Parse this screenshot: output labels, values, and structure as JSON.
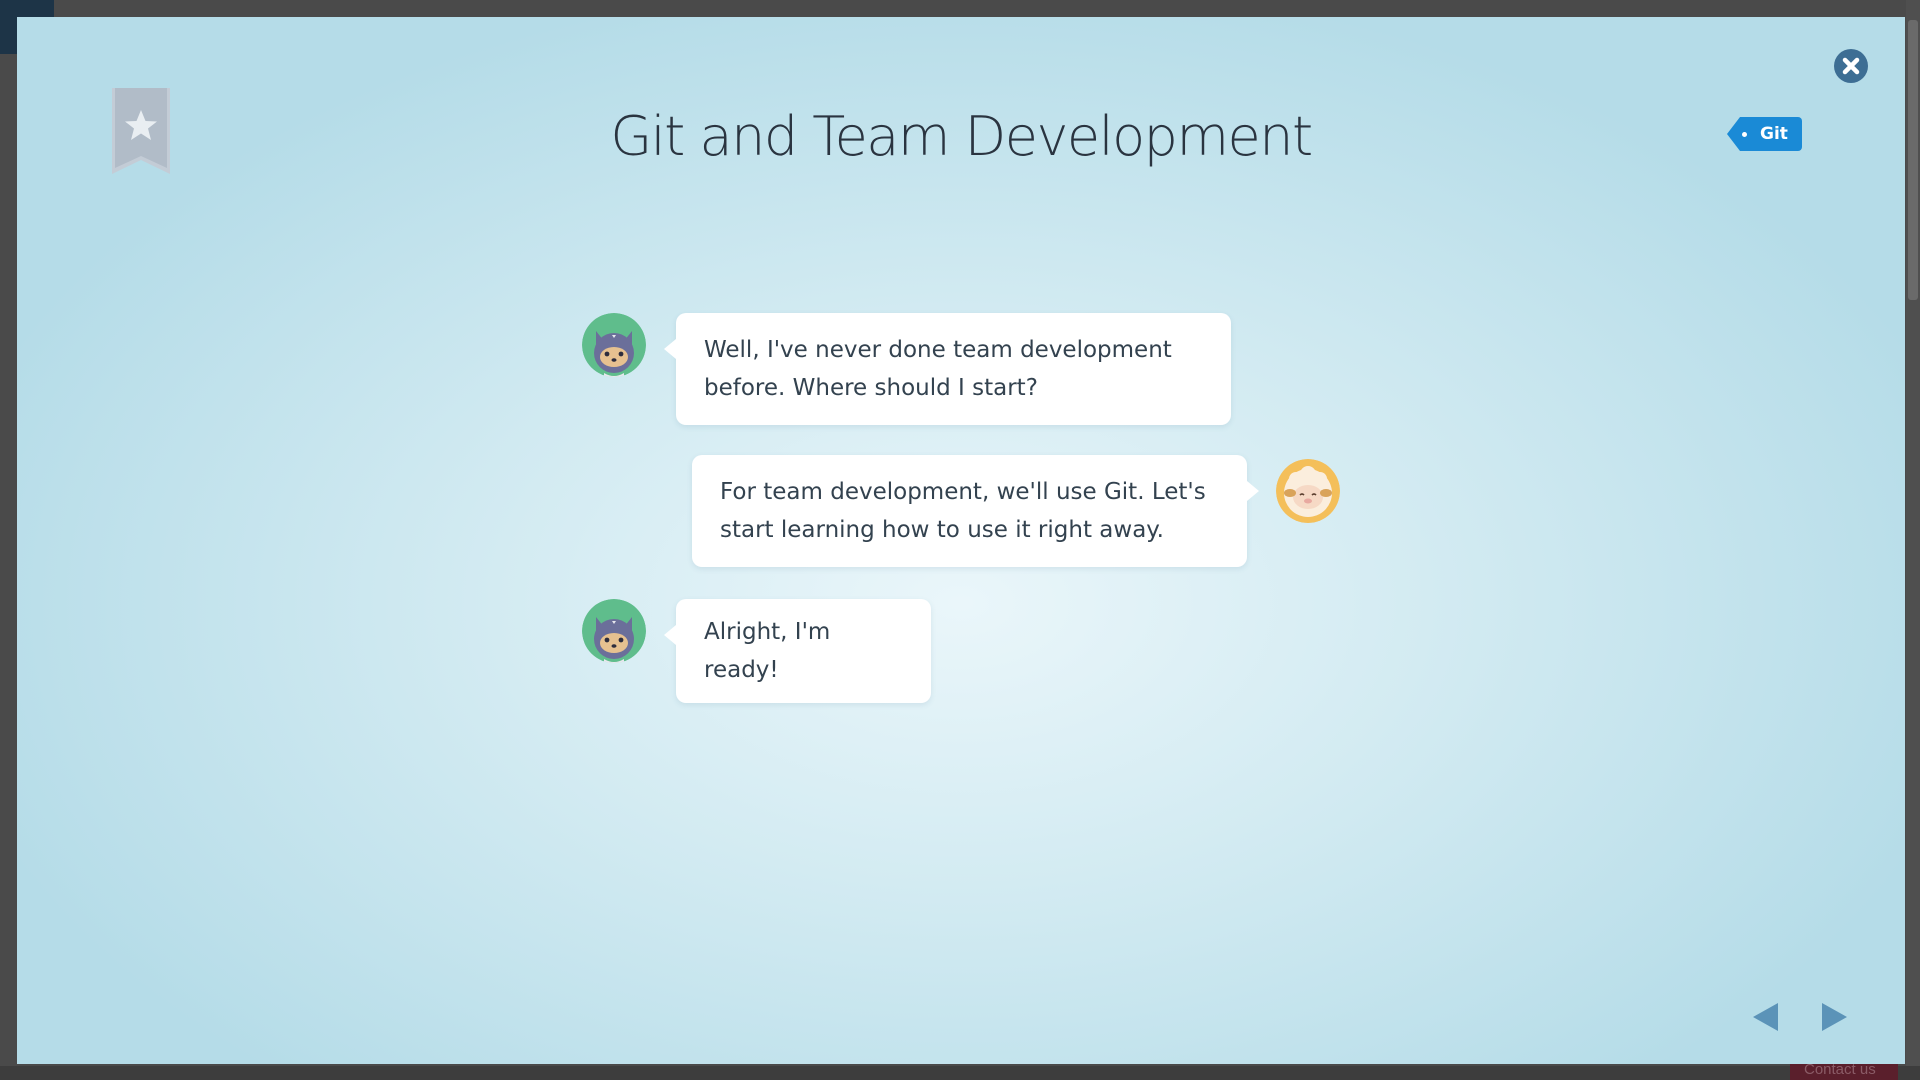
{
  "modal": {
    "title": "Git and Team Development",
    "tag": {
      "label": "Git",
      "color": "#1a8ad6"
    },
    "bookmark": {
      "icon": "star-icon",
      "state": "not-bookmarked"
    },
    "close": {
      "icon": "close-icon"
    }
  },
  "chat": {
    "messages": [
      {
        "speaker": "cat-character",
        "side": "left",
        "text": "Well, I've never done team development before. Where should I start?"
      },
      {
        "speaker": "sheep-character",
        "side": "right",
        "text": "For team development, we'll use Git. Let's start learning how to use it right away."
      },
      {
        "speaker": "cat-character",
        "side": "left",
        "text": "Alright, I'm ready!"
      }
    ]
  },
  "navigation": {
    "prev_icon": "triangle-left-icon",
    "next_icon": "triangle-right-icon"
  },
  "background_page": {
    "contact_label": "Contact us"
  },
  "colors": {
    "modal_bg": "#c9e6ef",
    "accent_blue": "#1a8ad6",
    "close_blue": "#3d6e94",
    "nav_blue": "#5b93b8"
  }
}
